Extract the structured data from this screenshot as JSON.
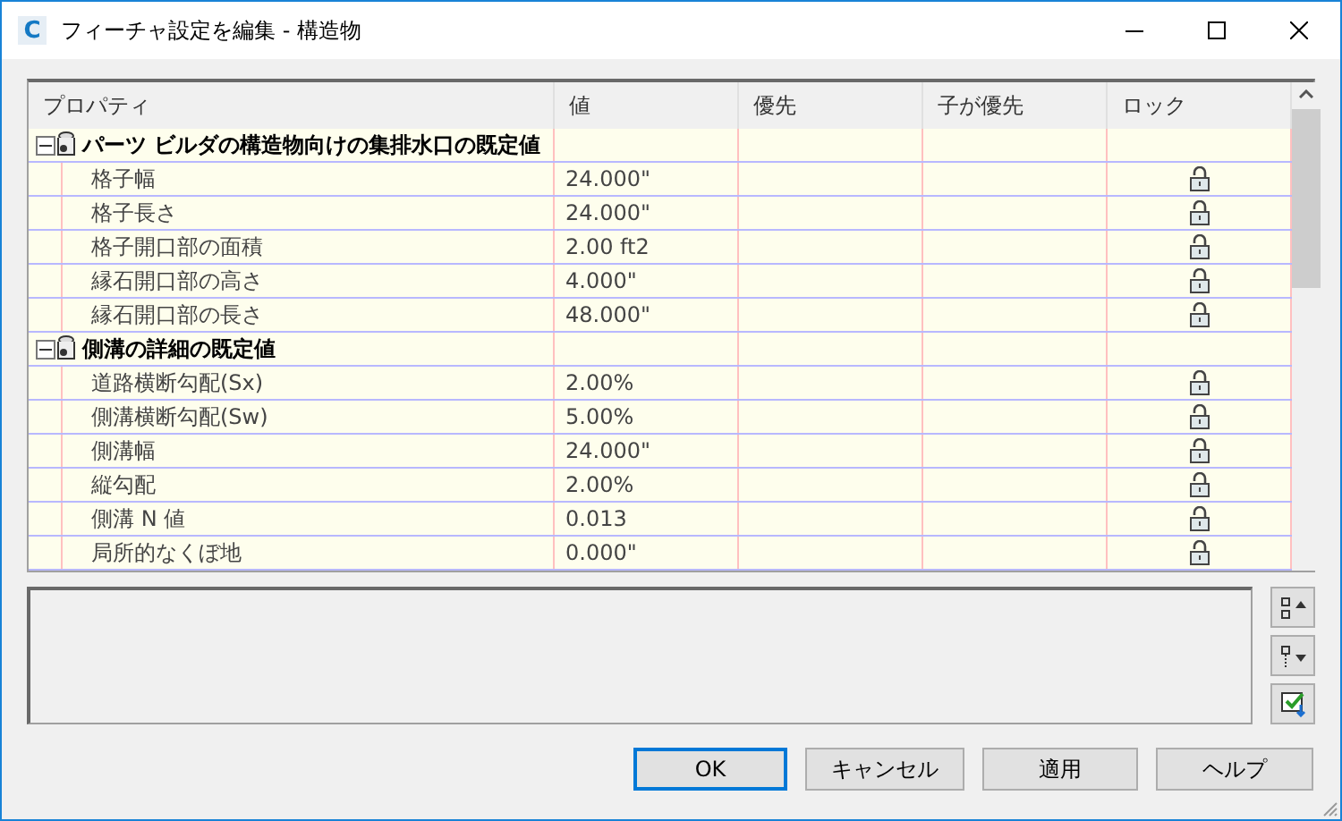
{
  "window": {
    "logo": "C",
    "title": "フィーチャ設定を編集 - 構造物"
  },
  "table": {
    "columns": [
      "プロパティ",
      "値",
      "優先",
      "子が優先",
      "ロック"
    ],
    "groups": [
      {
        "label": "パーツ ビルダの構造物向けの集排水口の既定値",
        "expanded": true,
        "rows": [
          {
            "name": "格子幅",
            "value": "24.000\"",
            "locked": false
          },
          {
            "name": "格子長さ",
            "value": "24.000\"",
            "locked": false
          },
          {
            "name": "格子開口部の面積",
            "value": "2.00 ft2",
            "locked": false
          },
          {
            "name": "縁石開口部の高さ",
            "value": "4.000\"",
            "locked": false
          },
          {
            "name": "縁石開口部の長さ",
            "value": "48.000\"",
            "locked": false
          }
        ]
      },
      {
        "label": "側溝の詳細の既定値",
        "expanded": true,
        "rows": [
          {
            "name": "道路横断勾配(Sx)",
            "value": "2.00%",
            "locked": false
          },
          {
            "name": "側溝横断勾配(Sw)",
            "value": "5.00%",
            "locked": false
          },
          {
            "name": "側溝幅",
            "value": "24.000\"",
            "locked": false
          },
          {
            "name": "縦勾配",
            "value": "2.00%",
            "locked": false
          },
          {
            "name": "側溝 N 値",
            "value": "0.013",
            "locked": false
          },
          {
            "name": "局所的なくぼ地",
            "value": "0.000\"",
            "locked": false
          }
        ]
      }
    ]
  },
  "buttons": [
    {
      "label": "OK",
      "default": true
    },
    {
      "label": "キャンセル",
      "default": false
    },
    {
      "label": "適用",
      "default": false
    },
    {
      "label": "ヘルプ",
      "default": false
    }
  ]
}
